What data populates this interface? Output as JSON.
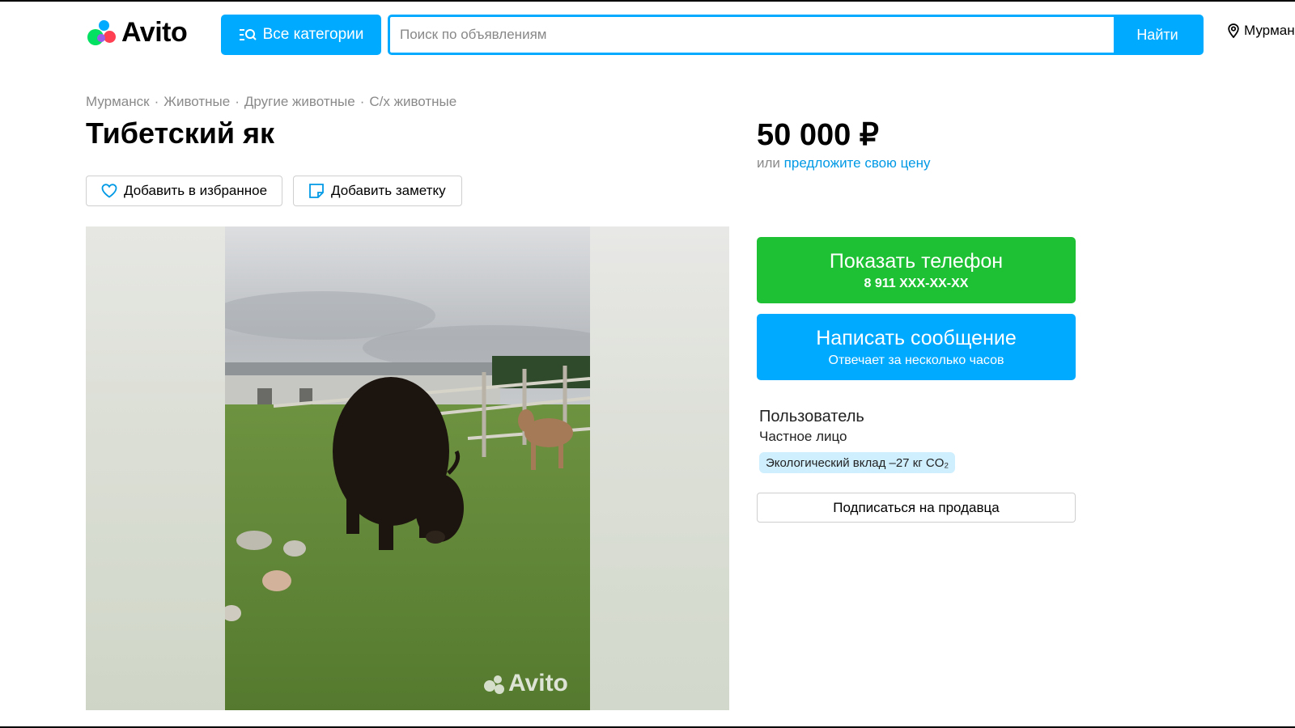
{
  "header": {
    "logo_text": "Avito",
    "categories_label": "Все категории",
    "search_placeholder": "Поиск по объявлениям",
    "search_button": "Найти",
    "location": "Мурман"
  },
  "breadcrumbs": [
    "Мурманск",
    "Животные",
    "Другие животные",
    "С/х животные"
  ],
  "listing": {
    "title": "Тибетский як",
    "favorite_label": "Добавить в избранное",
    "note_label": "Добавить заметку",
    "photo_watermark": "Avito"
  },
  "sidebar": {
    "price": "50 000 ₽",
    "price_prefix": "или",
    "price_offer_link": "предложите свою цену",
    "phone_button_label": "Показать телефон",
    "phone_number": "8 911 XXX-XX-XX",
    "message_button_label": "Написать сообщение",
    "message_button_sub": "Отвечает за несколько часов",
    "seller_name": "Пользователь",
    "seller_type": "Частное лицо",
    "eco_badge": "Экологический вклад –27 кг CO₂",
    "subscribe_label": "Подписаться на продавца"
  },
  "colors": {
    "brand_blue": "#00aaff",
    "phone_green": "#1fc134",
    "link_blue": "#0099e5"
  }
}
